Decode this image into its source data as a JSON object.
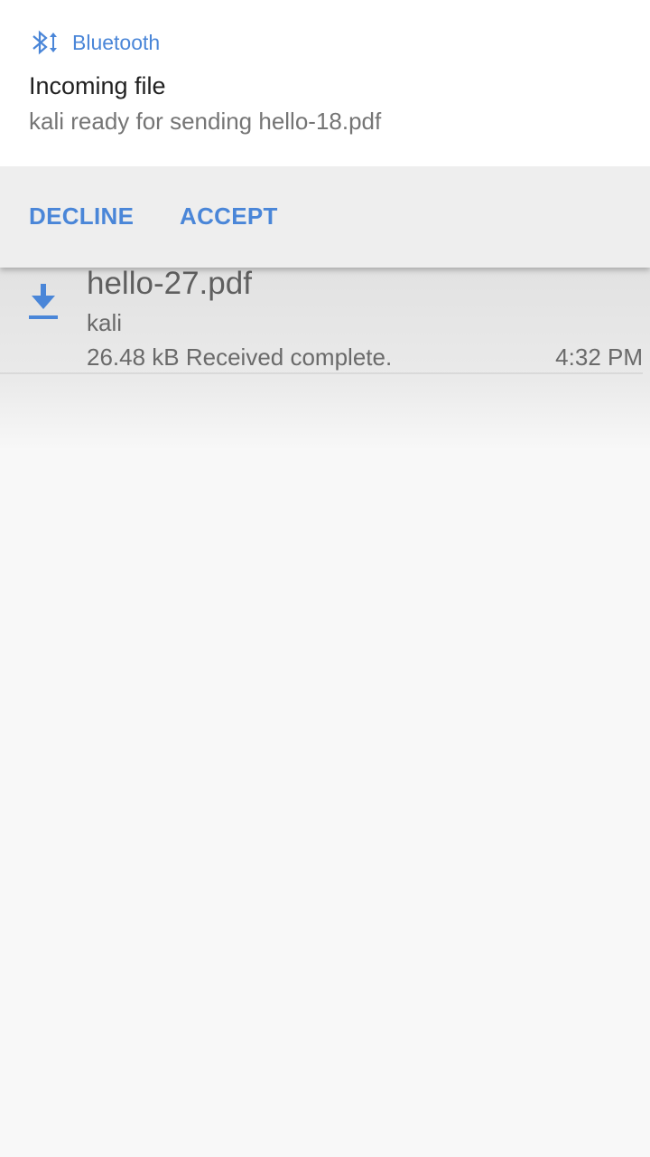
{
  "notification": {
    "app_name": "Bluetooth",
    "title": "Incoming file",
    "text": "kali ready for sending hello-18.pdf",
    "actions": {
      "decline_label": "DECLINE",
      "accept_label": "ACCEPT"
    },
    "icon": "bluetooth-transfer-icon"
  },
  "transfers": [
    {
      "file_name": "hello-27.pdf",
      "sender": "kali",
      "status": "26.48 kB Received complete.",
      "time": "4:32 PM",
      "icon": "download-icon"
    }
  ],
  "colors": {
    "accent": "#4a86d8",
    "notification_bg": "#ffffff",
    "actions_bg": "#eeeeee",
    "page_bg": "#f8f8f8"
  }
}
